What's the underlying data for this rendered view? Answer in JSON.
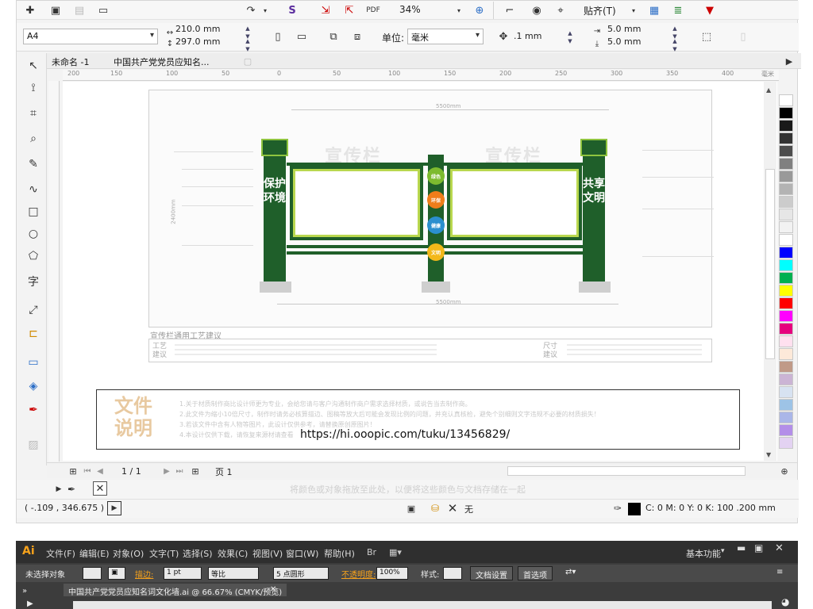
{
  "corel": {
    "toolbar1": {
      "zoom": "34%",
      "snap_label": "贴齐(T)"
    },
    "toolbar2": {
      "page_size": "A4",
      "width": "210.0 mm",
      "height": "297.0 mm",
      "units_label": "单位:",
      "units_value": "毫米",
      "nudge": ".1 mm",
      "dup_x": "5.0 mm",
      "dup_y": "5.0 mm"
    },
    "tabs": [
      "未命名 -1",
      "中国共产党党员应知名..."
    ],
    "ruler_ticks": [
      "200",
      "150",
      "100",
      "50",
      "0",
      "50",
      "100",
      "150",
      "200",
      "250",
      "300",
      "350",
      "400",
      "450",
      "500",
      "毫米"
    ],
    "billboard": {
      "dimension_width": "5500mm",
      "dimension_height": "2400mm",
      "ghost_title_left": "宣传栏",
      "ghost_title_right": "宣传栏",
      "left_post_text": "保护环境",
      "right_post_text": "共享文明",
      "flowers": [
        {
          "label": "绿色",
          "color": "#7dbb2f"
        },
        {
          "label": "环保",
          "color": "#ef7d1a"
        },
        {
          "label": "健康",
          "color": "#2b8fcf"
        },
        {
          "label": "文明",
          "color": "#f3b81a"
        }
      ],
      "spec_title": "宣传栏通用工艺建议",
      "spec_left_label": "工艺建议",
      "spec_right_label": "尺寸建议"
    },
    "notes": {
      "heading": "文件说明",
      "lines": [
        "1.关于材质制作商比设计师更为专业，会给您请与客户沟通制作商户需求选择材质，或说告当去制作商。",
        "2.此文件为缩小10倍尺寸，制作时请务必核算描边、图稿等放大后可能会发现比例的问题，并充认真核检，避免个别细则文字违规不必要的材质损失！",
        "3.若该文件中含有人物等图片，此设计仅供参考，请替换原创原图片！",
        "4.本设计仅供下载，请恢复来源材请查看"
      ],
      "url": "https://hi.ooopic.com/tuku/13456829/"
    },
    "page_nav": {
      "current": "1 / 1",
      "page_tab": "页 1"
    },
    "status_hint": "将颜色或对象拖放至此处，以便将这些颜色与文档存储在一起",
    "status": {
      "coords": "( -.109 , 346.675 )",
      "fill_label": "无",
      "outline_info": "C: 0 M: 0 Y: 0 K: 100  .200 mm"
    },
    "palette": [
      "#ffffff",
      "#000000",
      "#1a1a1a",
      "#333333",
      "#4d4d4d",
      "#808080",
      "#999999",
      "#b3b3b3",
      "#cccccc",
      "#e6e6e6",
      "#f2f2f2",
      "#ffffff",
      "#0000ff",
      "#00ffff",
      "#00b050",
      "#ffff00",
      "#ff0000",
      "#ff00ff",
      "#e6007e",
      "#ffe0ef",
      "#fde9d9",
      "#c09a88",
      "#cbb4d4",
      "#d7e2f1",
      "#9dc3e6",
      "#aab6e8",
      "#b38ee8",
      "#e3d2f2"
    ]
  },
  "ai": {
    "logo": "Ai",
    "menu": [
      "文件(F)",
      "编辑(E)",
      "对象(O)",
      "文字(T)",
      "选择(S)",
      "效果(C)",
      "视图(V)",
      "窗口(W)",
      "帮助(H)"
    ],
    "workspace": "基本功能",
    "control": {
      "selection": "未选择对象",
      "stroke_label": "描边:",
      "stroke_value": "1 pt",
      "profile": "等比",
      "brush": "5 点圆形",
      "opacity_label": "不透明度:",
      "opacity_value": "100%",
      "style_label": "样式:",
      "doc_setup": "文档设置",
      "prefs": "首选项"
    },
    "doc_tab": "中国共产党党员应知名词文化墙.ai @ 66.67% (CMYK/预览)"
  }
}
